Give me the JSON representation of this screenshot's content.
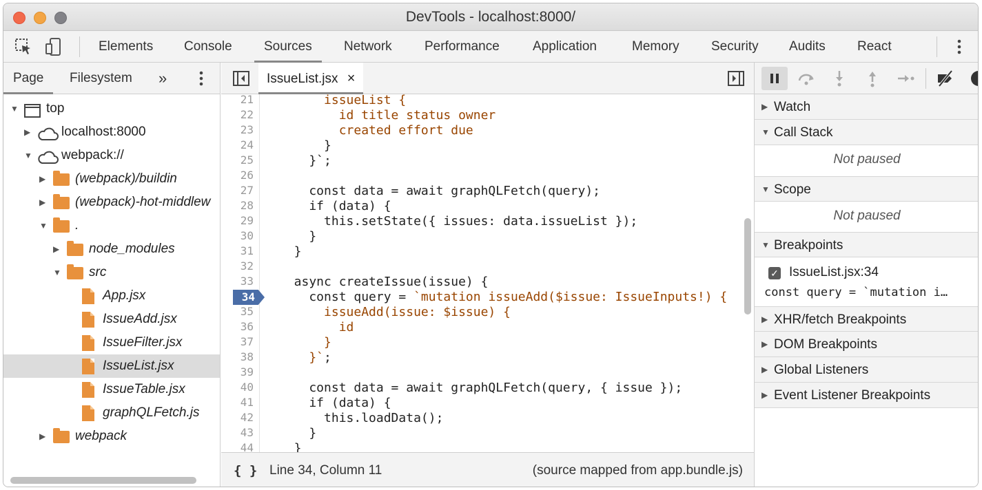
{
  "window": {
    "title": "DevTools - localhost:8000/"
  },
  "toolbar": {
    "tabs": [
      "Elements",
      "Console",
      "Sources",
      "Network",
      "Performance",
      "Application",
      "Memory",
      "Security",
      "Audits",
      "React"
    ],
    "active_tab": "Sources"
  },
  "navigator": {
    "tabs": [
      "Page",
      "Filesystem"
    ],
    "more_label": "»",
    "tree": [
      {
        "label": "top"
      },
      {
        "label": "localhost:8000"
      },
      {
        "label": "webpack://"
      },
      {
        "label": "(webpack)/buildin"
      },
      {
        "label": "(webpack)-hot-middlew"
      },
      {
        "label": "."
      },
      {
        "label": "node_modules"
      },
      {
        "label": "src"
      },
      {
        "label": "App.jsx"
      },
      {
        "label": "IssueAdd.jsx"
      },
      {
        "label": "IssueFilter.jsx"
      },
      {
        "label": "IssueList.jsx"
      },
      {
        "label": "IssueTable.jsx"
      },
      {
        "label": "graphQLFetch.js"
      },
      {
        "label": "webpack"
      }
    ]
  },
  "editor": {
    "tab_label": "IssueList.jsx",
    "close_glyph": "×",
    "breakpoint_line": "34",
    "lines": [
      {
        "n": "21",
        "text": "      issueList {"
      },
      {
        "n": "22",
        "text": "        id title status owner"
      },
      {
        "n": "23",
        "text": "        created effort due"
      },
      {
        "n": "24",
        "text": "      }"
      },
      {
        "n": "25",
        "text": "    }`;"
      },
      {
        "n": "26",
        "text": ""
      },
      {
        "n": "27",
        "text": "    const data = await graphQLFetch(query);"
      },
      {
        "n": "28",
        "text": "    if (data) {"
      },
      {
        "n": "29",
        "text": "      this.setState({ issues: data.issueList });"
      },
      {
        "n": "30",
        "text": "    }"
      },
      {
        "n": "31",
        "text": "  }"
      },
      {
        "n": "32",
        "text": ""
      },
      {
        "n": "33",
        "text": "  async createIssue(issue) {"
      },
      {
        "n": "34",
        "text": "    const query = `mutation issueAdd($issue: IssueInputs!) {"
      },
      {
        "n": "35",
        "text": "      issueAdd(issue: $issue) {"
      },
      {
        "n": "36",
        "text": "        id"
      },
      {
        "n": "37",
        "text": "      }"
      },
      {
        "n": "38",
        "text": "    }`;"
      },
      {
        "n": "39",
        "text": ""
      },
      {
        "n": "40",
        "text": "    const data = await graphQLFetch(query, { issue });"
      },
      {
        "n": "41",
        "text": "    if (data) {"
      },
      {
        "n": "42",
        "text": "      this.loadData();"
      },
      {
        "n": "43",
        "text": "    }"
      },
      {
        "n": "44",
        "text": "  }"
      }
    ],
    "status": {
      "format_glyph": "{ }",
      "position": "Line 34, Column 11",
      "source_map": "(source mapped from app.bundle.js)"
    }
  },
  "debugger": {
    "sections": {
      "watch": "Watch",
      "call_stack": "Call Stack",
      "scope": "Scope",
      "breakpoints": "Breakpoints",
      "xhr": "XHR/fetch Breakpoints",
      "dom": "DOM Breakpoints",
      "global": "Global Listeners",
      "event": "Event Listener Breakpoints"
    },
    "not_paused": "Not paused",
    "breakpoint": {
      "location": "IssueList.jsx:34",
      "code": "const query = `mutation i…",
      "checked": true
    }
  },
  "colors": {
    "string": "#994500",
    "breakpoint": "#4a6da7",
    "folder": "#e8913c"
  }
}
